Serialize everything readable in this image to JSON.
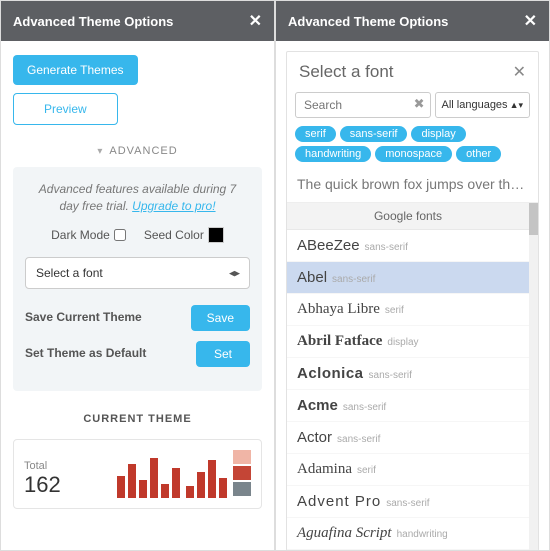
{
  "panelTitle": "Advanced Theme Options",
  "left": {
    "generateBtn": "Generate Themes",
    "previewBtn": "Preview",
    "advancedLabel": "ADVANCED",
    "trialLine1": "Advanced features available during 7",
    "trialLine2": "day free trial. ",
    "upgradeLink": "Upgrade to pro!",
    "darkModeLabel": "Dark Mode",
    "seedColorLabel": "Seed Color",
    "seedColorHex": "#000000",
    "fontSelectPlaceholder": "Select a font",
    "saveThemeLabel": "Save Current Theme",
    "saveBtn": "Save",
    "setDefaultLabel": "Set Theme as Default",
    "setBtn": "Set",
    "currentThemeLabel": "CURRENT THEME",
    "totalLabel": "Total",
    "totalValue": "162"
  },
  "right": {
    "title": "Select a font",
    "searchPlaceholder": "Search",
    "langFilter": "All languages",
    "categories": [
      "serif",
      "sans-serif",
      "display",
      "handwriting",
      "monospace",
      "other"
    ],
    "sampleText": "The quick brown fox jumps over the la...",
    "groupLabel": "Google fonts",
    "fonts": [
      {
        "name": "ABeeZee",
        "tag": "sans-serif",
        "style": "font-family:Arial"
      },
      {
        "name": "Abel",
        "tag": "sans-serif",
        "style": "font-family:Arial;font-weight:300",
        "active": true
      },
      {
        "name": "Abhaya Libre",
        "tag": "serif",
        "style": "font-family:'Times New Roman',serif"
      },
      {
        "name": "Abril Fatface",
        "tag": "display",
        "style": "font-family:Georgia,serif;font-weight:900"
      },
      {
        "name": "Aclonica",
        "tag": "sans-serif",
        "style": "font-family:Impact,Arial;font-weight:700;letter-spacing:0.5px"
      },
      {
        "name": "Acme",
        "tag": "sans-serif",
        "style": "font-family:Verdana,sans-serif;font-weight:700"
      },
      {
        "name": "Actor",
        "tag": "sans-serif",
        "style": "font-family:Arial"
      },
      {
        "name": "Adamina",
        "tag": "serif",
        "style": "font-family:Georgia,serif"
      },
      {
        "name": "Advent Pro",
        "tag": "sans-serif",
        "style": "font-family:Arial;font-weight:300;letter-spacing:1px"
      },
      {
        "name": "Aguafina Script",
        "tag": "handwriting",
        "style": "font-family:'Brush Script MT',cursive;font-style:italic"
      }
    ]
  }
}
